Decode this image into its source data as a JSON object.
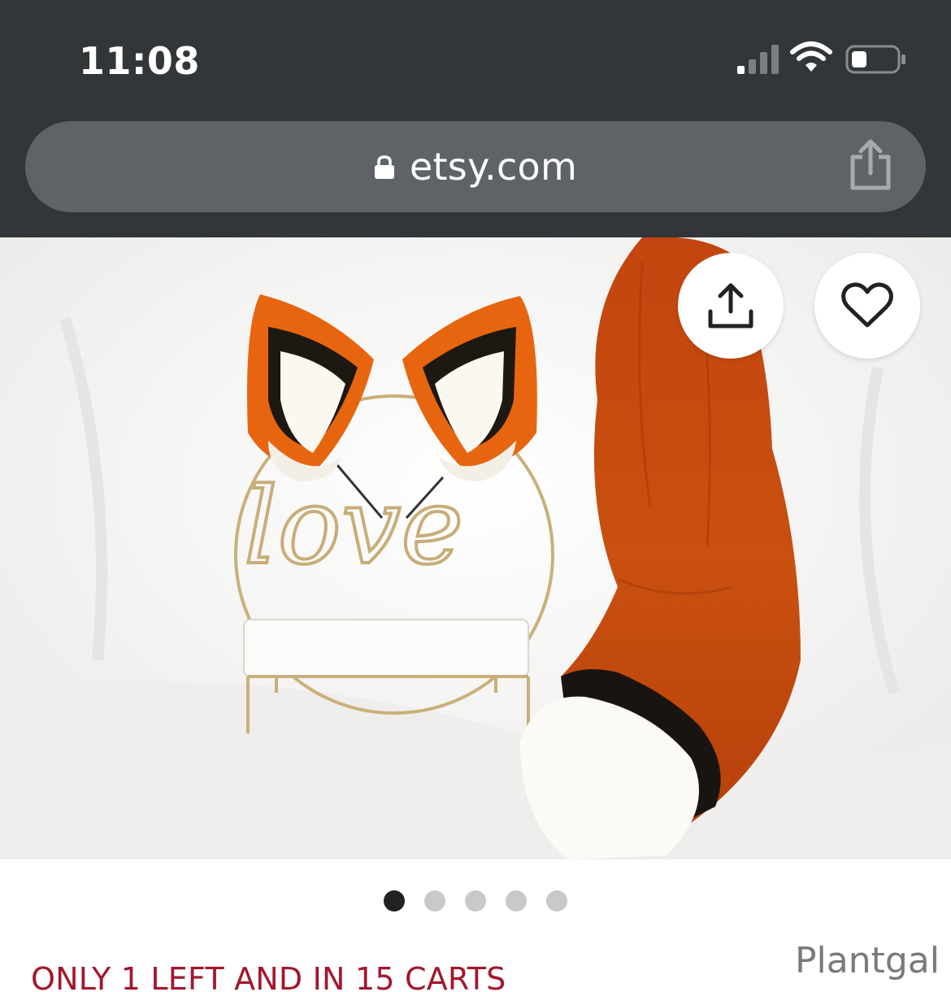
{
  "status_bar": {
    "time": "11:08",
    "signal_icon": "cellular-signal-icon",
    "wifi_icon": "wifi-icon",
    "battery_icon": "battery-icon",
    "battery_level": 0.3
  },
  "browser": {
    "url": "etsy.com",
    "lock_icon": "lock-icon",
    "share_icon": "share-icon"
  },
  "product": {
    "image_alt": "",
    "image_sign_text": "love",
    "share_button_icon": "share-icon",
    "favorite_button_icon": "heart-icon",
    "carousel": {
      "total": 5,
      "active_index": 0
    },
    "stock_message": "ONLY 1 LEFT AND IN 15 CARTS",
    "shop_name": "Plantgal"
  },
  "colors": {
    "chrome_bg": "#323639",
    "url_bar_bg": "#5f6367",
    "stock_red": "#a3172b",
    "dot_active": "#222222",
    "dot_inactive": "#c9c9c9"
  }
}
